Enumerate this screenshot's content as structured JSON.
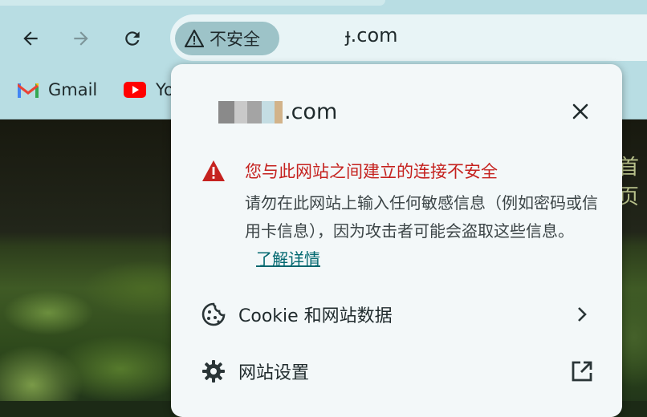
{
  "toolbar": {
    "back_icon": "arrow-left-icon",
    "forward_icon": "arrow-right-icon",
    "reload_icon": "reload-icon",
    "security_chip": {
      "icon": "warning-triangle-icon",
      "label": "不安全"
    },
    "url": "ɟ.com"
  },
  "bookmarks": [
    {
      "icon": "gmail-icon",
      "label": "Gmail"
    },
    {
      "icon": "youtube-icon",
      "label": "Yo"
    }
  ],
  "page": {
    "partial_text": "首页"
  },
  "popup": {
    "site_suffix": ".com",
    "close_icon": "close-icon",
    "warning": {
      "icon": "warning-triangle-icon",
      "title": "您与此网站之间建立的连接不安全",
      "body": "请勿在此网站上输入任何敏感信息（例如密码或信用卡信息），因为攻击者可能会盗取这些信息。",
      "link": "了解详情"
    },
    "rows": [
      {
        "icon": "cookie-icon",
        "label": "Cookie 和网站数据",
        "trail_icon": "chevron-right-icon"
      },
      {
        "icon": "gear-icon",
        "label": "网站设置",
        "trail_icon": "open-in-new-icon"
      }
    ]
  },
  "colors": {
    "toolbar_bg": "#b8dde3",
    "popup_bg": "#f3f8f9",
    "warning_red": "#c5221f",
    "link_teal": "#00676f"
  }
}
